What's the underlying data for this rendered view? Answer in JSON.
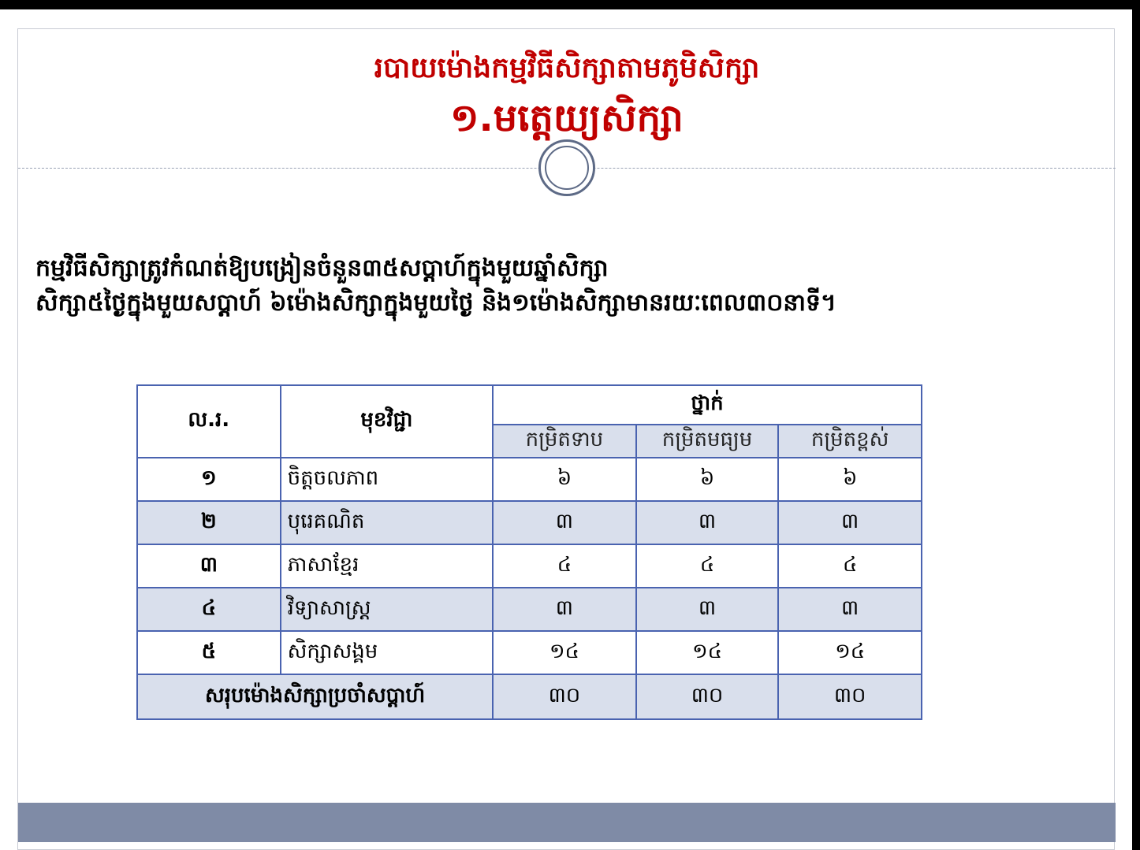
{
  "slide": {
    "title_line1": "របាយម៉ោងកម្មវិធីសិក្សាតាមភូមិសិក្សា",
    "title_line2": "១.មត្តេយ្យសិក្សា",
    "paragraph_line1": "កម្មវិធីសិក្សាត្រូវកំណត់ឱ្យបង្រៀនចំនួន៣៥សប្តាហ៍ក្នុងមួយឆ្នាំសិក្សា",
    "paragraph_line2": "សិក្សា៥ថ្ងៃក្នុងមួយសប្តាហ៍ ៦ម៉ោងសិក្សាក្នុងមួយថ្ងៃ និង១ម៉ោងសិក្សាមានរយៈពេល៣០នាទី។"
  },
  "table": {
    "header": {
      "no": "ល.រ.",
      "subject": "មុខវិជ្ជា",
      "grade": "ថ្នាក់",
      "levels": [
        "កម្រិតទាប",
        "កម្រិតមធ្យម",
        "កម្រិតខ្ពស់"
      ]
    },
    "rows": [
      {
        "no": "១",
        "subject": "ចិត្តចលភាព",
        "low": "៦",
        "mid": "៦",
        "high": "៦"
      },
      {
        "no": "២",
        "subject": "បុរេគណិត",
        "low": "៣",
        "mid": "៣",
        "high": "៣"
      },
      {
        "no": "៣",
        "subject": "ភាសាខ្មែរ",
        "low": "៤",
        "mid": "៤",
        "high": "៤"
      },
      {
        "no": "៤",
        "subject": "វិទ្យាសាស្ត្រ",
        "low": "៣",
        "mid": "៣",
        "high": "៣"
      },
      {
        "no": "៥",
        "subject": "សិក្សាសង្គម",
        "low": "១៤",
        "mid": "១៤",
        "high": "១៤"
      }
    ],
    "total": {
      "label": "សរុបម៉ោងសិក្សាប្រចាំសប្តាហ៍",
      "low": "៣០",
      "mid": "៣០",
      "high": "៣០"
    }
  },
  "colors": {
    "title": "#c00000",
    "table_border": "#4a63b0",
    "row_alt": "#d9dfec",
    "footer_bar": "#7f8ba6"
  }
}
